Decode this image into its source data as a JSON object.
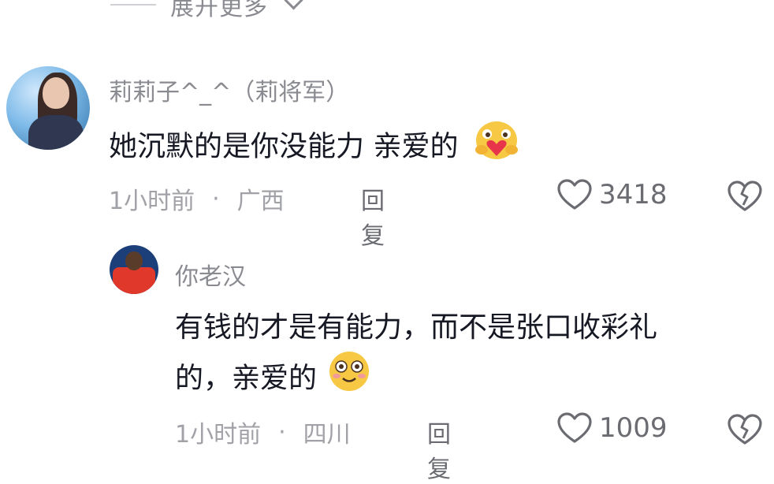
{
  "thread": {
    "expand_label": "展开更多"
  },
  "comments": [
    {
      "username": "莉莉子^_^（莉将军）",
      "text": "她沉默的是你没能力 亲爱的",
      "emoji": "hug-face-emoji",
      "time": "1小时前",
      "location": "广西",
      "reply_label": "回复",
      "likes": "3418"
    }
  ],
  "replies": [
    {
      "username": "你老汉",
      "text_line1": "有钱的才是有能力，而不是张口收彩礼",
      "text_line2": "的，亲爱的",
      "emoji": "smile-face-emoji",
      "time": "1小时前",
      "location": "四川",
      "reply_label": "回复",
      "likes": "1009"
    }
  ],
  "meta_separator": "·",
  "icons": {
    "like": "heart-outline-icon",
    "dislike": "broken-heart-icon",
    "expand": "chevron-down-icon"
  },
  "colors": {
    "primary_text": "#161823",
    "secondary_text": "#8a8b91",
    "meta_text": "#a1a2a7"
  }
}
